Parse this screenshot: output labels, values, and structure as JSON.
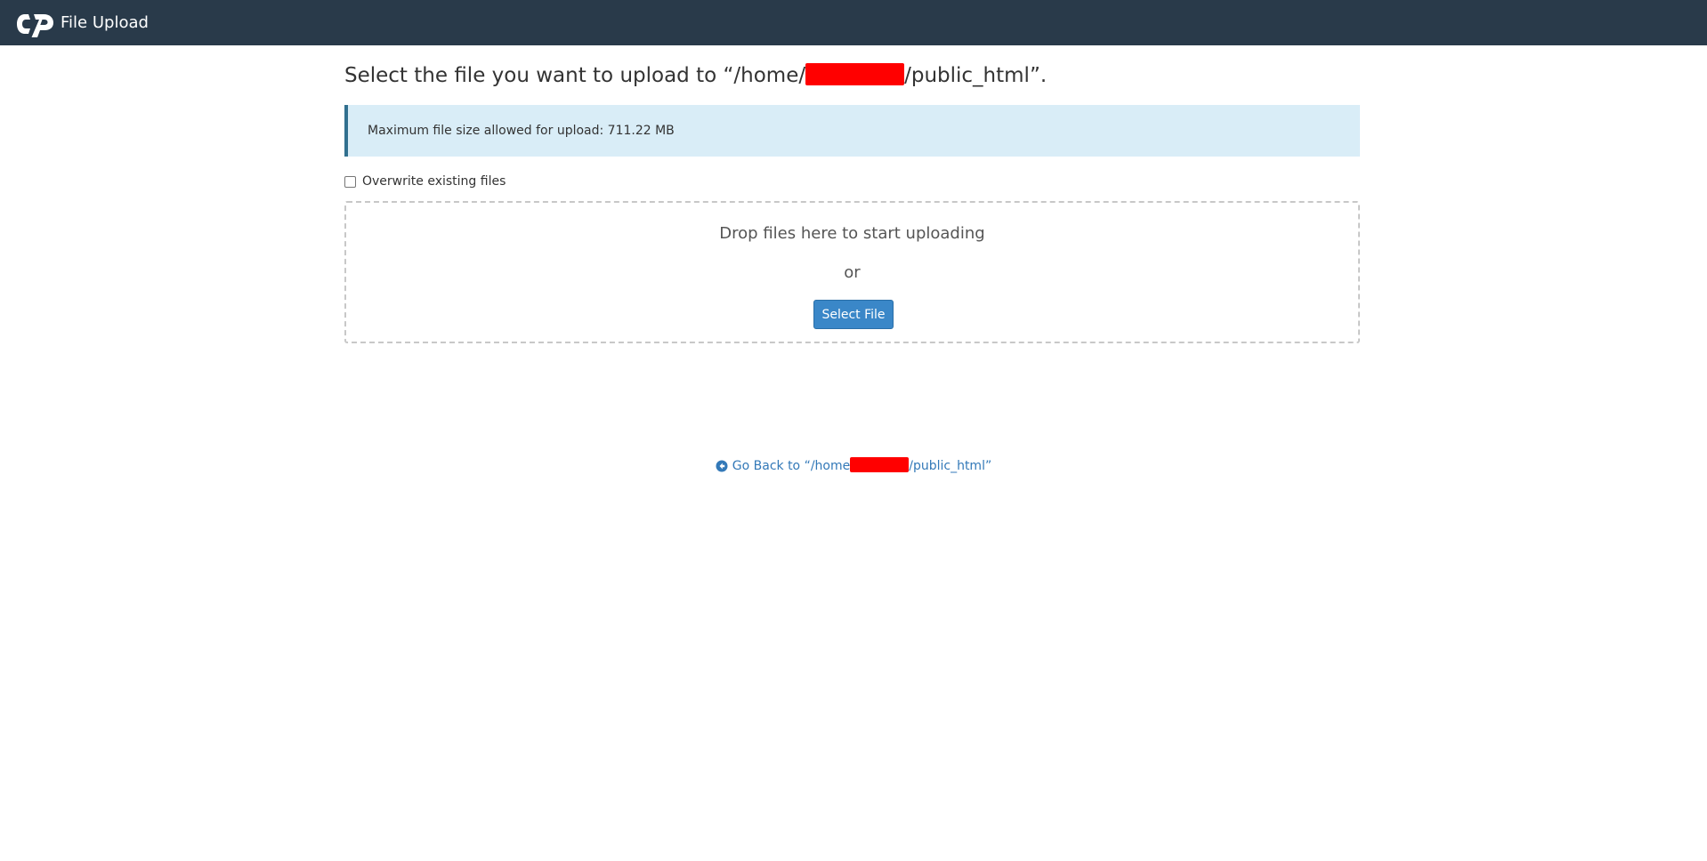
{
  "header": {
    "app_title": "File Upload",
    "logo_icon": "cpanel-logo-icon"
  },
  "main": {
    "title_prefix": "Select the file you want to upload to “/home/",
    "title_suffix": "/public_html”.",
    "max_size_message": "Maximum file size allowed for upload: 711.22 MB",
    "overwrite_label": "Overwrite existing files",
    "overwrite_checked": false,
    "drop_text": "Drop files here to start uploading",
    "or_text": "or",
    "select_file_label": "Select File",
    "go_back_prefix": "Go Back to “/home",
    "go_back_suffix": "/public_html”",
    "go_back_icon": "arrow-circle-left-icon"
  },
  "colors": {
    "header_bg": "#293a4a",
    "alert_bg": "#d9edf7",
    "alert_border": "#31708f",
    "button_bg": "#3a87c8",
    "link": "#3379b8",
    "redaction": "#ff0000"
  }
}
